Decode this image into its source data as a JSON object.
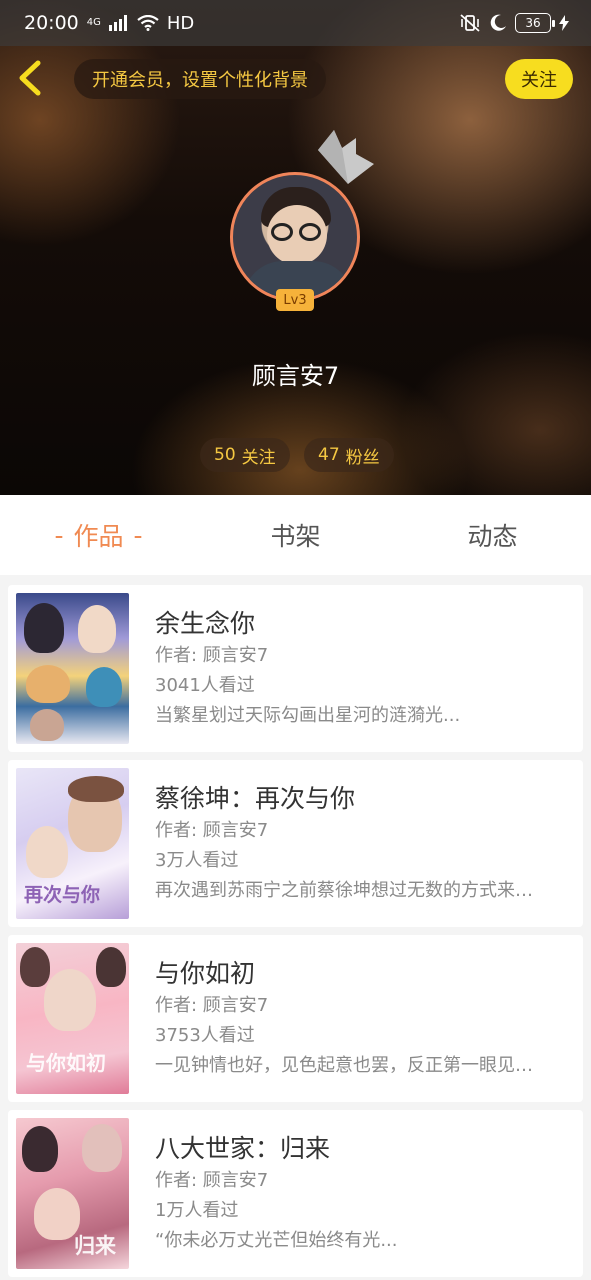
{
  "status_bar": {
    "time": "20:00",
    "network": "4G",
    "hd": "HD",
    "battery": "36"
  },
  "header": {
    "vip_prompt": "开通会员，设置个性化背景",
    "follow_label": "关注",
    "level": "Lv3",
    "username": "顾言安7",
    "following_count": "50",
    "following_label": "关注",
    "fans_count": "47",
    "fans_label": "粉丝"
  },
  "tabs": [
    {
      "label": "作品",
      "active": true
    },
    {
      "label": "书架",
      "active": false
    },
    {
      "label": "动态",
      "active": false
    }
  ],
  "works": [
    {
      "title": "余生念你",
      "author": "作者: 顾言安7",
      "views": "3041人看过",
      "description": "当繁星划过天际勾画出星河的涟漪光..."
    },
    {
      "title": "蔡徐坤：再次与你",
      "author": "作者: 顾言安7",
      "views": "3万人看过",
      "description": "再次遇到苏雨宁之前蔡徐坤想过无数的方式来…"
    },
    {
      "title": "与你如初",
      "author": "作者: 顾言安7",
      "views": "3753人看过",
      "description": "一见钟情也好，见色起意也罢，反正第一眼见…"
    },
    {
      "title": "八大世家：归来",
      "author": "作者: 顾言安7",
      "views": "1万人看过",
      "description": "“你未必万丈光芒但始终有光..."
    }
  ],
  "cover_texts": {
    "cover_2": "再次与你",
    "cover_3": "与你如初",
    "cover_4": "归来"
  }
}
